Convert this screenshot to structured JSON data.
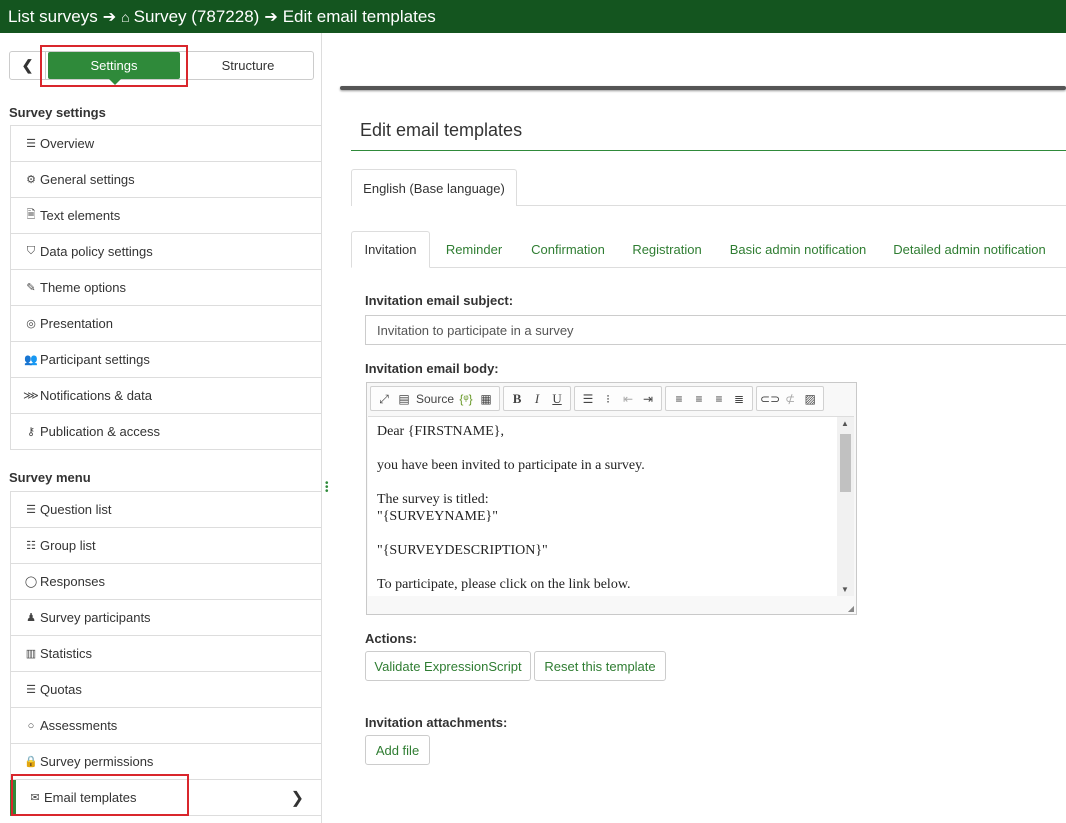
{
  "breadcrumb": {
    "list_surveys": "List surveys",
    "survey": "Survey (787228)",
    "current": "Edit email templates"
  },
  "sidebar": {
    "tab_settings": "Settings",
    "tab_structure": "Structure",
    "survey_settings_title": "Survey settings",
    "settings_items": [
      {
        "label": "Overview",
        "icon": "list-icon"
      },
      {
        "label": "General settings",
        "icon": "gears-icon"
      },
      {
        "label": "Text elements",
        "icon": "file-text-icon"
      },
      {
        "label": "Data policy settings",
        "icon": "shield-icon"
      },
      {
        "label": "Theme options",
        "icon": "paint-brush-icon"
      },
      {
        "label": "Presentation",
        "icon": "eye-slash-icon"
      },
      {
        "label": "Participant settings",
        "icon": "users-icon"
      },
      {
        "label": "Notifications & data",
        "icon": "feed-icon"
      },
      {
        "label": "Publication & access",
        "icon": "key-icon"
      }
    ],
    "survey_menu_title": "Survey menu",
    "menu_items": [
      {
        "label": "Question list",
        "icon": "list-icon"
      },
      {
        "label": "Group list",
        "icon": "th-list-icon"
      },
      {
        "label": "Responses",
        "icon": "comment-icon"
      },
      {
        "label": "Survey participants",
        "icon": "user-icon"
      },
      {
        "label": "Statistics",
        "icon": "bar-chart-icon"
      },
      {
        "label": "Quotas",
        "icon": "tasks-icon"
      },
      {
        "label": "Assessments",
        "icon": "comment-o-icon"
      },
      {
        "label": "Survey permissions",
        "icon": "lock-icon"
      },
      {
        "label": "Email templates",
        "icon": "envelope-icon",
        "active": true
      }
    ]
  },
  "main": {
    "title": "Edit email templates",
    "language_tab": "English (Base language)",
    "tabs": [
      "Invitation",
      "Reminder",
      "Confirmation",
      "Registration",
      "Basic admin notification",
      "Detailed admin notification"
    ],
    "active_tab": "Invitation",
    "subject_label": "Invitation email subject:",
    "subject_value": "Invitation to participate in a survey",
    "body_label": "Invitation email body:",
    "editor_toolbar": {
      "source_label": "Source"
    },
    "body_lines": [
      "Dear {FIRSTNAME},",
      "",
      "you have been invited to participate in a survey.",
      "",
      "The survey is titled:",
      "\"{SURVEYNAME}\"",
      "",
      "\"{SURVEYDESCRIPTION}\"",
      "",
      "To participate, please click on the link below."
    ],
    "actions_label": "Actions:",
    "validate_button": "Validate ExpressionScript",
    "reset_button": "Reset this template",
    "attachments_label": "Invitation attachments:",
    "add_file_button": "Add file"
  },
  "colors": {
    "topbar": "#14551f",
    "accent": "#2f8a3a",
    "highlight": "#d9262c"
  }
}
